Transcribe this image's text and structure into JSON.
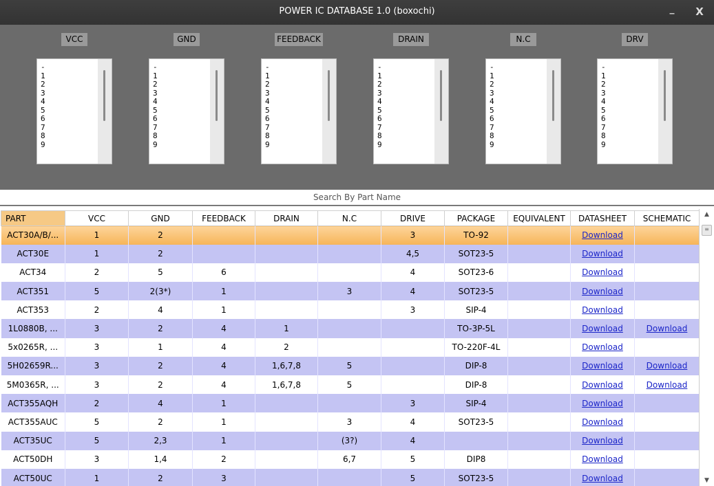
{
  "window": {
    "title": "POWER IC DATABASE 1.0 (boxochi)",
    "minimize_label": "_",
    "close_label": "X"
  },
  "filters": [
    {
      "label": "VCC",
      "options": [
        "-",
        "1",
        "2",
        "3",
        "4",
        "5",
        "6",
        "7",
        "8",
        "9"
      ]
    },
    {
      "label": "GND",
      "options": [
        "-",
        "1",
        "2",
        "3",
        "4",
        "5",
        "6",
        "7",
        "8",
        "9"
      ]
    },
    {
      "label": "FEEDBACK",
      "options": [
        "-",
        "1",
        "2",
        "3",
        "4",
        "5",
        "6",
        "7",
        "8",
        "9"
      ]
    },
    {
      "label": "DRAIN",
      "options": [
        "-",
        "1",
        "2",
        "3",
        "4",
        "5",
        "6",
        "7",
        "8",
        "9"
      ]
    },
    {
      "label": "N.C",
      "options": [
        "-",
        "1",
        "2",
        "3",
        "4",
        "5",
        "6",
        "7",
        "8",
        "9"
      ]
    },
    {
      "label": "DRV",
      "options": [
        "-",
        "1",
        "2",
        "3",
        "4",
        "5",
        "6",
        "7",
        "8",
        "9"
      ]
    }
  ],
  "search_label": "Search By Part Name",
  "table": {
    "headers": [
      "PART",
      "VCC",
      "GND",
      "FEEDBACK",
      "DRAIN",
      "N.C",
      "DRIVE",
      "PACKAGE",
      "EQUIVALENT",
      "DATASHEET",
      "SCHEMATIC"
    ],
    "rows": [
      [
        "ACT30A/B/...",
        "1",
        "2",
        "",
        "",
        "",
        "3",
        "TO-92",
        "",
        "Download",
        ""
      ],
      [
        "ACT30E",
        "1",
        "2",
        "",
        "",
        "",
        "4,5",
        "SOT23-5",
        "",
        "Download",
        ""
      ],
      [
        "ACT34",
        "2",
        "5",
        "6",
        "",
        "",
        "4",
        "SOT23-6",
        "",
        "Download",
        ""
      ],
      [
        "ACT351",
        "5",
        "2(3*)",
        "1",
        "",
        "3",
        "4",
        "SOT23-5",
        "",
        "Download",
        ""
      ],
      [
        "ACT353",
        "2",
        "4",
        "1",
        "",
        "",
        "3",
        "SIP-4",
        "",
        "Download",
        ""
      ],
      [
        "1L0880B, ...",
        "3",
        "2",
        "4",
        "1",
        "",
        "",
        "TO-3P-5L",
        "",
        "Download",
        "Download"
      ],
      [
        "5x0265R, ...",
        "3",
        "1",
        "4",
        "2",
        "",
        "",
        "TO-220F-4L",
        "",
        "Download",
        ""
      ],
      [
        "5H02659R...",
        "3",
        "2",
        "4",
        "1,6,7,8",
        "5",
        "",
        "DIP-8",
        "",
        "Download",
        "Download"
      ],
      [
        "5M0365R, ...",
        "3",
        "2",
        "4",
        "1,6,7,8",
        "5",
        "",
        "DIP-8",
        "",
        "Download",
        "Download"
      ],
      [
        "ACT355AQH",
        "2",
        "4",
        "1",
        "",
        "",
        "3",
        "SIP-4",
        "",
        "Download",
        ""
      ],
      [
        "ACT355AUC",
        "5",
        "2",
        "1",
        "",
        "3",
        "4",
        "SOT23-5",
        "",
        "Download",
        ""
      ],
      [
        "ACT35UC",
        "5",
        "2,3",
        "1",
        "",
        "(3?)",
        "4",
        "",
        "",
        "Download",
        ""
      ],
      [
        "ACT50DH",
        "3",
        "1,4",
        "2",
        "",
        "6,7",
        "5",
        "DIP8",
        "",
        "Download",
        ""
      ],
      [
        "ACT50UC",
        "1",
        "2",
        "3",
        "",
        "",
        "5",
        "SOT23-5",
        "",
        "Download",
        ""
      ]
    ],
    "selected_row": 0
  },
  "scrollbar": {
    "up_icon": "▲",
    "down_icon": "▼",
    "thumb_icon": "≡"
  }
}
